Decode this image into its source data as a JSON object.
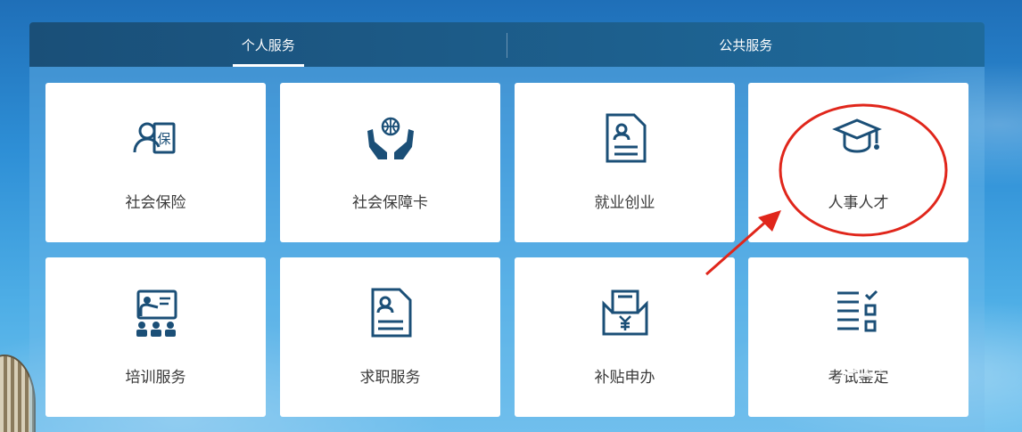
{
  "tabs": [
    {
      "label": "个人服务",
      "active": true
    },
    {
      "label": "公共服务",
      "active": false
    }
  ],
  "services": [
    {
      "label": "社会保险",
      "icon": "insurance-person-icon"
    },
    {
      "label": "社会保障卡",
      "icon": "globe-hands-icon"
    },
    {
      "label": "就业创业",
      "icon": "resume-document-icon"
    },
    {
      "label": "人事人才",
      "icon": "graduation-cap-icon"
    },
    {
      "label": "培训服务",
      "icon": "training-presenter-icon"
    },
    {
      "label": "求职服务",
      "icon": "job-document-icon"
    },
    {
      "label": "补贴申办",
      "icon": "yuan-subsidy-icon"
    },
    {
      "label": "考试鉴定",
      "icon": "checklist-icon"
    }
  ],
  "watermark": {
    "main": "Bai 经验",
    "sub": "jingyan.baidu.com"
  },
  "colors": {
    "icon": "#1b4f77",
    "annotation": "#e0261b",
    "tab_bar": "#1d5f8d"
  }
}
